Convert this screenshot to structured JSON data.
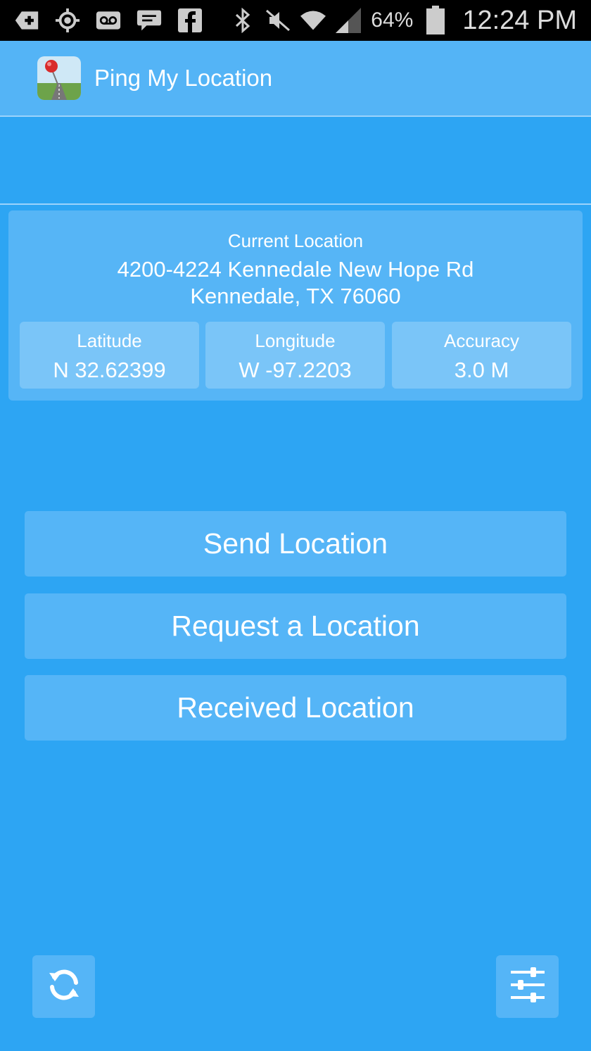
{
  "status_bar": {
    "icons_left": [
      "add-icon",
      "gps-icon",
      "voicemail-icon",
      "message-icon",
      "facebook-icon"
    ],
    "icons_right": [
      "bluetooth-icon",
      "mute-icon",
      "wifi-icon",
      "signal-icon",
      "battery-icon"
    ],
    "battery": "64%",
    "time": "12:24 PM"
  },
  "app_bar": {
    "title": "Ping My Location",
    "icon": "map-pin-app-icon"
  },
  "location_card": {
    "label": "Current Location",
    "address_line1": "4200-4224 Kennedale New Hope Rd",
    "address_line2": "Kennedale, TX 76060",
    "latitude": {
      "label": "Latitude",
      "value": "N 32.62399"
    },
    "longitude": {
      "label": "Longitude",
      "value": "W -97.2203"
    },
    "accuracy": {
      "label": "Accuracy",
      "value": "3.0 M"
    }
  },
  "buttons": {
    "send": "Send Location",
    "request": "Request a Location",
    "received": "Received Location"
  },
  "bottom": {
    "refresh_icon": "refresh-icon",
    "settings_icon": "sliders-icon"
  },
  "colors": {
    "background": "#2da5f3",
    "surface": "#55b5f7",
    "cell": "#7ac5f8"
  }
}
